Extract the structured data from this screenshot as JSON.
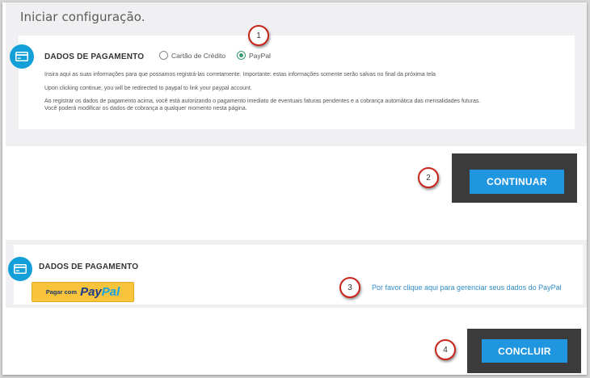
{
  "page": {
    "title": "Iniciar configuração."
  },
  "payment_section": {
    "heading": "DADOS DE PAGAMENTO",
    "icon": "credit-card-icon",
    "options": [
      {
        "label": "Cartão de Crédito",
        "selected": false
      },
      {
        "label": "PayPal",
        "selected": true
      }
    ],
    "info_lines": [
      "Insira aqui as suas informações para que possamos registrá-las corretamente. Importante: estas informações somente serão salvas no final da próxima tela",
      "Upon clicking continue, you will be redirected to paypal to link your paypal account.",
      "Ao registrar os dados de pagamento acima, você está autorizando o pagamento imediato de eventuais faturas pendentes e a cobrança automática das mensalidades futuras.",
      "Você poderá modificar os dados de cobrança a qualquer momento nesta página."
    ]
  },
  "continue_button": {
    "label": "CONTINUAR"
  },
  "paypal_section": {
    "heading": "DADOS DE PAGAMENTO",
    "icon": "credit-card-icon",
    "paypal_button": {
      "prefix": "Pagar com",
      "brand_pay": "Pay",
      "brand_pal": "Pal"
    },
    "manage_link": "Por favor clique aqui para gerenciar seus dados do PayPal"
  },
  "finish_button": {
    "label": "CONCLUIR"
  },
  "callouts": [
    "1",
    "2",
    "3",
    "4"
  ],
  "colors": {
    "accent": "#1f96df",
    "icon_bg": "#139fd8",
    "callout_border": "#c8241c",
    "paypal_yellow": "#f8c43b",
    "link": "#2e8dc8"
  }
}
